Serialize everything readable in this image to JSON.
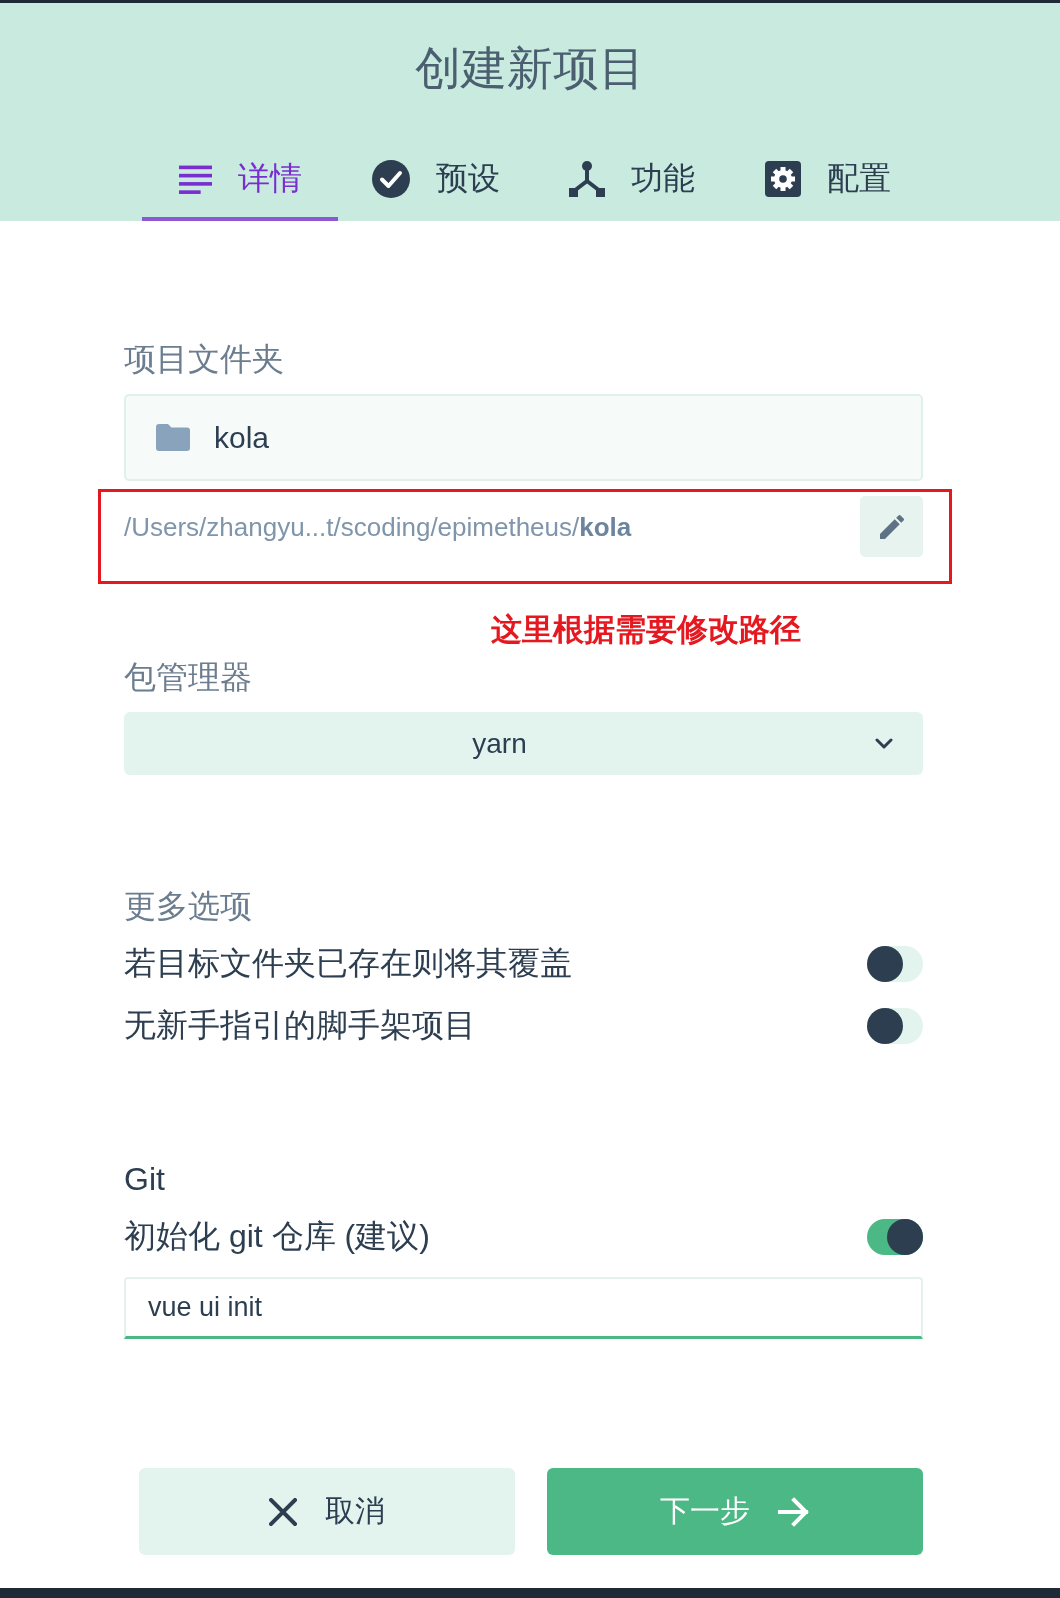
{
  "window": {
    "title": "创建新项目"
  },
  "tabs": [
    {
      "label": "详情",
      "selected": true
    },
    {
      "label": "预设",
      "selected": false
    },
    {
      "label": "功能",
      "selected": false
    },
    {
      "label": "配置",
      "selected": false
    }
  ],
  "project_folder": {
    "label": "项目文件夹",
    "value": "kola",
    "path": "/Users/zhangyu...t/scoding/epimetheus/**kola**"
  },
  "annotation": {
    "highlight_path": true,
    "note": "这里根据需要修改路径"
  },
  "package_manager": {
    "label": "包管理器",
    "value": "yarn"
  },
  "more_options": {
    "label": "更多选项",
    "options": [
      {
        "label": "若目标文件夹已存在则将其覆盖",
        "on": false
      },
      {
        "label": "无新手指引的脚手架项目",
        "on": false
      }
    ]
  },
  "git": {
    "label": "Git",
    "options": [
      {
        "label": "初始化 git 仓库 (建议)",
        "on": true
      }
    ],
    "commit_message": {
      "value": "vue ui init"
    }
  },
  "buttons": [
    {
      "label": "取消",
      "kind": "cancel"
    },
    {
      "label": "下一步",
      "kind": "next"
    }
  ]
}
